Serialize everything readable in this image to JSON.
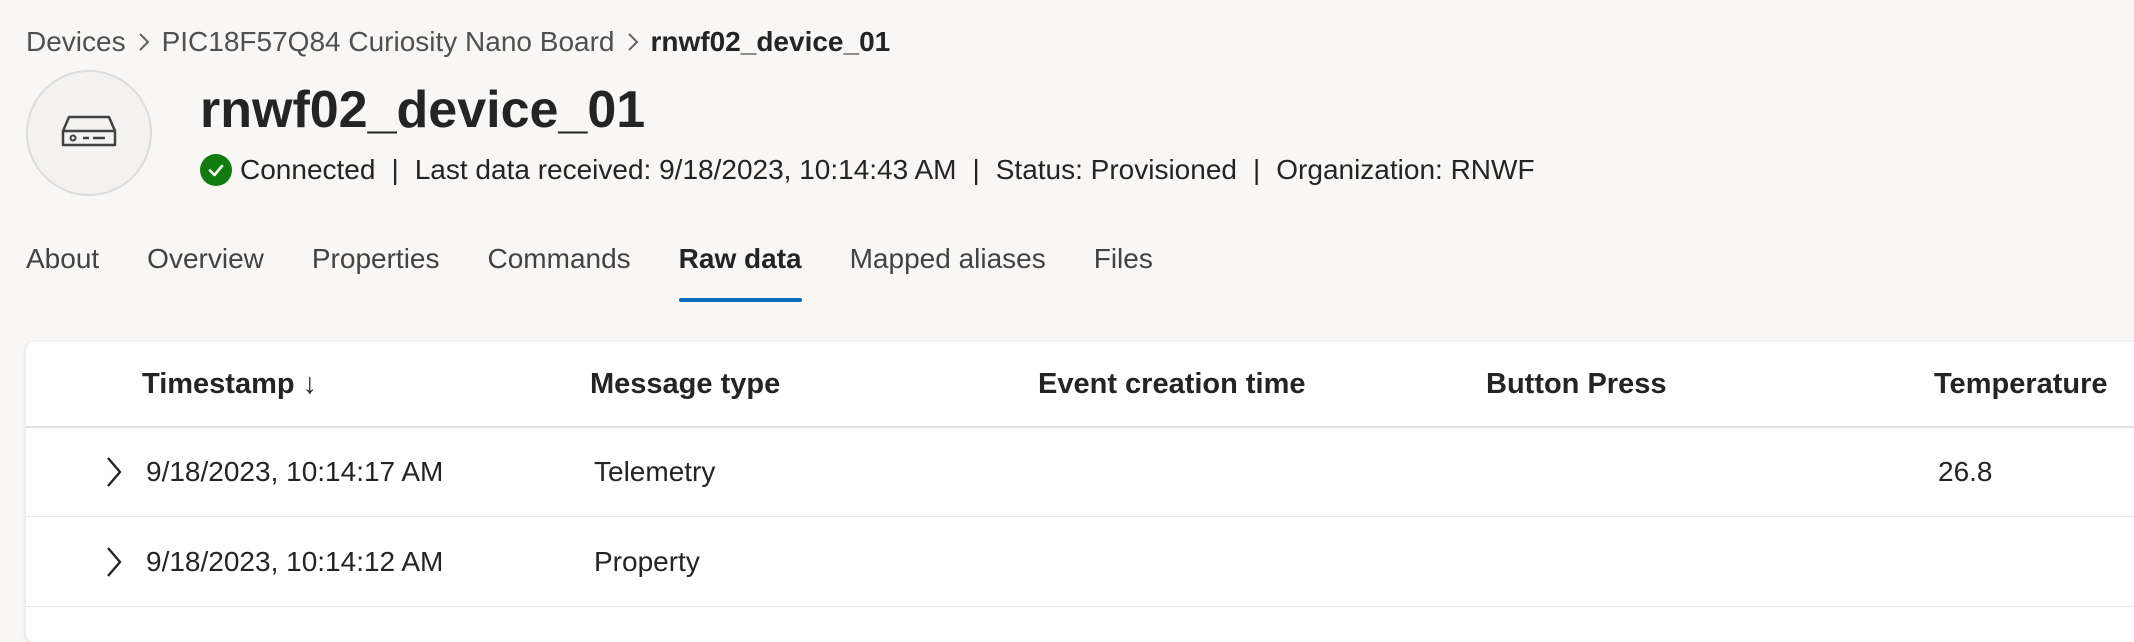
{
  "breadcrumb": {
    "items": [
      "Devices",
      "PIC18F57Q84 Curiosity Nano Board"
    ],
    "current": "rnwf02_device_01"
  },
  "device": {
    "icon": "device-icon",
    "name": "rnwf02_device_01",
    "connection": "Connected",
    "last_data": "Last data received: 9/18/2023, 10:14:43 AM",
    "status": "Status: Provisioned",
    "organization": "Organization: RNWF",
    "separator": "|"
  },
  "tabs": {
    "items": [
      "About",
      "Overview",
      "Properties",
      "Commands",
      "Raw data",
      "Mapped aliases",
      "Files"
    ],
    "active": "Raw data"
  },
  "table": {
    "columns": [
      "Timestamp ↓",
      "Message type",
      "Event creation time",
      "Button Press",
      "Temperature"
    ],
    "rows": [
      {
        "timestamp": "9/18/2023, 10:14:17 AM",
        "message_type": "Telemetry",
        "event_creation_time": "",
        "button_press": "",
        "temperature": "26.8"
      },
      {
        "timestamp": "9/18/2023, 10:14:12 AM",
        "message_type": "Property",
        "event_creation_time": "",
        "button_press": "",
        "temperature": ""
      }
    ]
  },
  "colors": {
    "accent": "#0f6cbd",
    "success": "#107c10",
    "background": "#f8f7f6"
  }
}
